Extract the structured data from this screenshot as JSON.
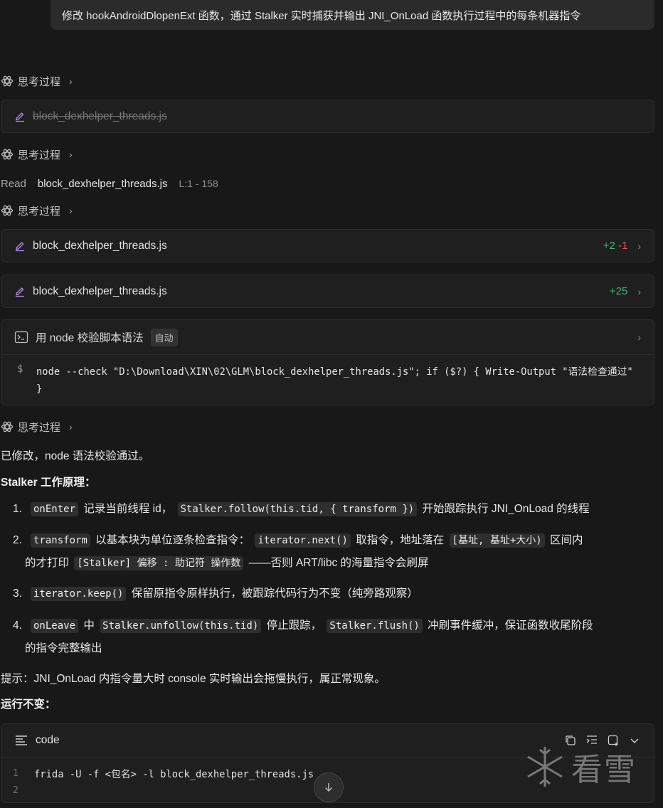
{
  "user_message": "修改 hookAndroidDlopenExt 函数，通过 Stalker 实时捕获并输出 JNI_OnLoad 函数执行过程中的每条机器指令",
  "thinking_label": "思考过程",
  "file_cards": [
    {
      "name": "block_dexhelper_threads.js",
      "added": "",
      "removed": ""
    },
    {
      "name": "block_dexhelper_threads.js",
      "added": "+2",
      "removed": "-1"
    },
    {
      "name": "block_dexhelper_threads.js",
      "added": "+25",
      "removed": ""
    }
  ],
  "read": {
    "action": "Read",
    "file": "block_dexhelper_threads.js",
    "range": "L:1 - 158"
  },
  "terminal": {
    "title": "用 node 校验脚本语法",
    "badge": "自动",
    "prompt": "$",
    "command": "node --check \"D:\\Download\\XIN\\02\\GLM\\block_dexhelper_threads.js\"; if ($?) { Write-Output \"语法检查通过\" }"
  },
  "summary": "已修改，node 语法校验通过。",
  "principle_heading": "Stalker 工作原理：",
  "list": [
    {
      "num": "1.",
      "parts": [
        [
          "c",
          "onEnter"
        ],
        [
          "t",
          " 记录当前线程 id， "
        ],
        [
          "c",
          "Stalker.follow(this.tid, { transform })"
        ],
        [
          "t",
          " 开始跟踪执行 JNI_OnLoad 的线程"
        ]
      ],
      "parts2": []
    },
    {
      "num": "2.",
      "parts": [
        [
          "c",
          "transform"
        ],
        [
          "t",
          " 以基本块为单位逐条检查指令： "
        ],
        [
          "c",
          "iterator.next()"
        ],
        [
          "t",
          " 取指令，地址落在 "
        ],
        [
          "c",
          "[基址, 基址+大小)"
        ],
        [
          "t",
          " 区间内"
        ]
      ],
      "parts2": [
        [
          "t",
          "的才打印 "
        ],
        [
          "c",
          "[Stalker] 偏移 : 助记符 操作数"
        ],
        [
          "t",
          " ——否则 ART/libc 的海量指令会刷屏"
        ]
      ]
    },
    {
      "num": "3.",
      "parts": [
        [
          "c",
          "iterator.keep()"
        ],
        [
          "t",
          " 保留原指令原样执行，被跟踪代码行为不变（纯旁路观察）"
        ]
      ],
      "parts2": []
    },
    {
      "num": "4.",
      "parts": [
        [
          "c",
          "onLeave"
        ],
        [
          "t",
          " 中 "
        ],
        [
          "c",
          "Stalker.unfollow(this.tid)"
        ],
        [
          "t",
          " 停止跟踪， "
        ],
        [
          "c",
          "Stalker.flush()"
        ],
        [
          "t",
          " 冲刷事件缓冲，保证函数收尾阶段"
        ]
      ],
      "parts2": [
        [
          "t",
          "的指令完整输出"
        ]
      ]
    }
  ],
  "tip": "提示：JNI_OnLoad 内指令量大时 console 实时输出会拖慢执行，属正常现象。",
  "run_heading": "运行不变：",
  "code_block": {
    "lang": "code",
    "lines": [
      {
        "n": "1",
        "text": "frida -U -f <包名> -l block_dexhelper_threads.js"
      },
      {
        "n": "2",
        "text": ""
      }
    ]
  },
  "watermark": "看雪",
  "colors": {
    "added": "#3fb37f",
    "removed": "#e05d5d",
    "background": "#181818"
  }
}
